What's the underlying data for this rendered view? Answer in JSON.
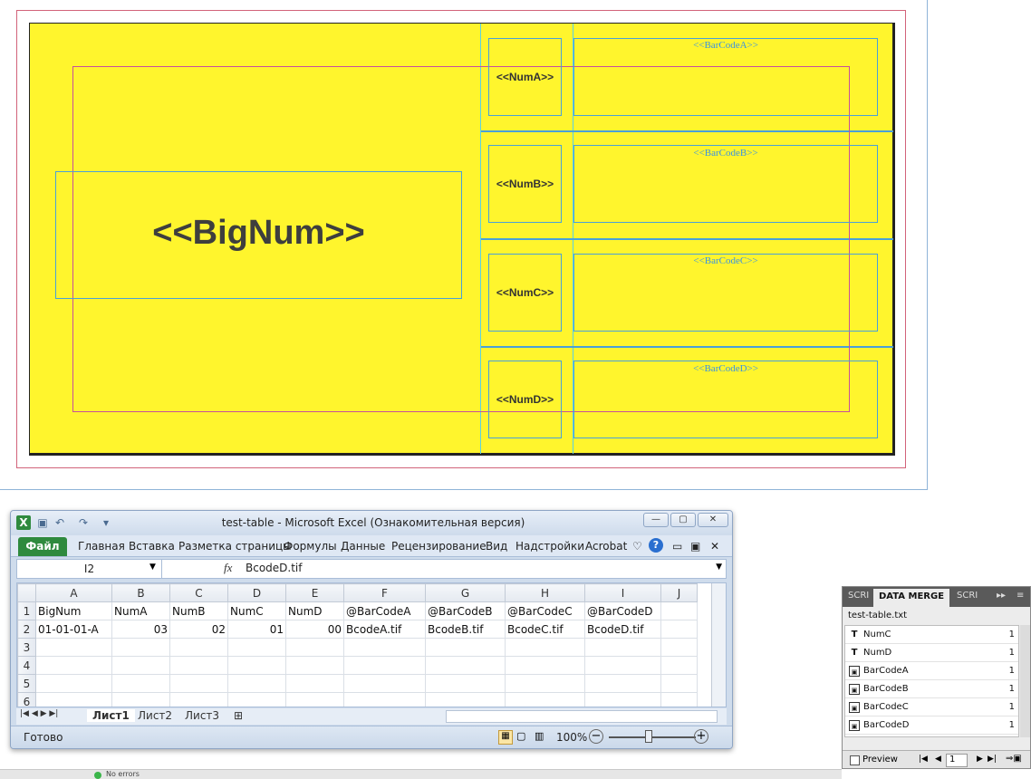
{
  "layout_page": {
    "big_num": "<<BigNum>>",
    "nums": [
      "<<NumA>>",
      "<<NumB>>",
      "<<NumC>>",
      "<<NumD>>"
    ],
    "barcodes": [
      "<<BarCodeA>>",
      "<<BarCodeB>>",
      "<<BarCodeC>>",
      "<<BarCodeD>>"
    ],
    "colors": {
      "page_fill": "#fff52d",
      "frame_blue": "#4aa0d8",
      "bleed": "#d2637a",
      "margin": "#c8509a",
      "text": "#3e3e3e"
    }
  },
  "excel": {
    "title": "test-table  -  Microsoft Excel (Ознакомительная версия)",
    "icons": [
      "excel-logo-icon",
      "save-icon",
      "undo-icon",
      "redo-icon",
      "customize-icon"
    ],
    "file_tab": "Файл",
    "ribbon_tabs": [
      "Главная",
      "Вставка",
      "Разметка страницы",
      "Формулы",
      "Данные",
      "Рецензирование",
      "Вид",
      "Надстройки",
      "Acrobat"
    ],
    "name_box": "I2",
    "fx_symbol": "fx",
    "formula_value": "BcodeD.tif",
    "columns": [
      "A",
      "B",
      "C",
      "D",
      "E",
      "F",
      "G",
      "H",
      "I",
      "J"
    ],
    "rows": [
      {
        "num": "1",
        "cells": [
          "BigNum",
          "NumA",
          "NumB",
          "NumC",
          "NumD",
          "@BarCodeA",
          "@BarCodeB",
          "@BarCodeC",
          "@BarCodeD",
          ""
        ]
      },
      {
        "num": "2",
        "cells": [
          "01-01-01-A",
          "03",
          "02",
          "01",
          "00",
          "BcodeA.tif",
          "BcodeB.tif",
          "BcodeC.tif",
          "BcodeD.tif",
          ""
        ]
      },
      {
        "num": "3",
        "cells": [
          "",
          "",
          "",
          "",
          "",
          "",
          "",
          "",
          "",
          ""
        ]
      },
      {
        "num": "4",
        "cells": [
          "",
          "",
          "",
          "",
          "",
          "",
          "",
          "",
          "",
          ""
        ]
      },
      {
        "num": "5",
        "cells": [
          "",
          "",
          "",
          "",
          "",
          "",
          "",
          "",
          "",
          ""
        ]
      },
      {
        "num": "6",
        "cells": [
          "",
          "",
          "",
          "",
          "",
          "",
          "",
          "",
          "",
          ""
        ]
      }
    ],
    "sheet_tabs": [
      "Лист1",
      "Лист2",
      "Лист3"
    ],
    "status": "Готово",
    "zoom": "100%",
    "zoom_minus": "−",
    "zoom_plus": "+"
  },
  "data_merge": {
    "tabs": [
      "SCRI",
      "DATA MERGE",
      "SCRI"
    ],
    "file": "test-table.txt",
    "fields": [
      {
        "type": "T",
        "name": "NumC",
        "count": "1"
      },
      {
        "type": "T",
        "name": "NumD",
        "count": "1"
      },
      {
        "type": "img",
        "name": "BarCodeA",
        "count": "1"
      },
      {
        "type": "img",
        "name": "BarCodeB",
        "count": "1"
      },
      {
        "type": "img",
        "name": "BarCodeC",
        "count": "1"
      },
      {
        "type": "img",
        "name": "BarCodeD",
        "count": "1"
      }
    ],
    "preview_label": "Preview",
    "record": "1"
  },
  "bottom_status": "No errors"
}
